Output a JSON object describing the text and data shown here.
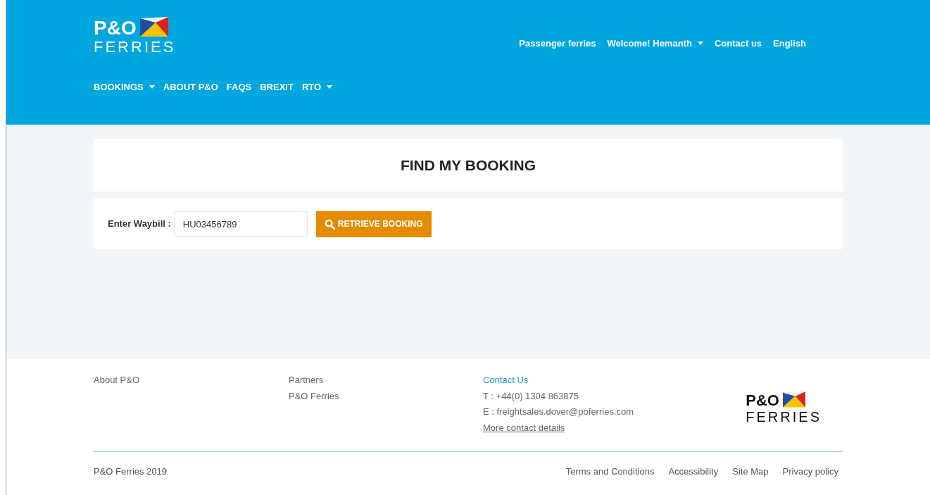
{
  "header": {
    "logo": {
      "brand": "P&O",
      "name": "FERRIES"
    },
    "top_links": [
      {
        "label": "Passenger ferries",
        "dropdown": false
      },
      {
        "label": "Welcome! Hemanth",
        "dropdown": true
      },
      {
        "label": "Contact us",
        "dropdown": false
      },
      {
        "label": "English",
        "dropdown": false
      }
    ],
    "main_nav": [
      {
        "label": "BOOKINGS",
        "dropdown": true
      },
      {
        "label": "ABOUT P&O",
        "dropdown": false
      },
      {
        "label": "FAQS",
        "dropdown": false
      },
      {
        "label": "BREXIT",
        "dropdown": false
      },
      {
        "label": "RTO",
        "dropdown": true
      }
    ]
  },
  "page_title": "FIND MY BOOKING",
  "form": {
    "label": "Enter Waybill :",
    "waybill": "HU03456789",
    "button": "RETRIEVE BOOKING"
  },
  "footer": {
    "columns": [
      {
        "links": [
          {
            "text": "About P&O",
            "kind": "link"
          }
        ]
      },
      {
        "links": [
          {
            "text": "Partners",
            "kind": "link"
          },
          {
            "text": "P&O Ferries",
            "kind": "link"
          }
        ]
      },
      {
        "links": [
          {
            "text": "Contact Us",
            "kind": "heading"
          },
          {
            "text": "T : +44(0) 1304 863875",
            "kind": "text"
          },
          {
            "text": "E : freightsales.dover@poferries.com",
            "kind": "text"
          },
          {
            "text": "More contact details",
            "kind": "underlined"
          }
        ]
      }
    ],
    "logo": {
      "brand": "P&O",
      "name": "FERRIES"
    },
    "copyright": "P&O Ferries 2019",
    "bottom_links": [
      "Terms and Conditions",
      "Accessibility",
      "Site Map",
      "Privacy policy"
    ]
  }
}
